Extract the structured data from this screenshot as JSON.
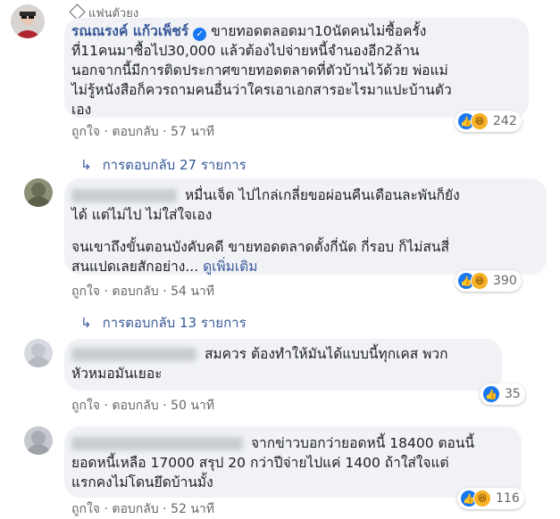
{
  "top_badge": {
    "label": "แฟนตัวยง"
  },
  "comments": [
    {
      "author": "รณณรงค์ แก้วเพ็ชร์",
      "lines": [
        "ขายทอดตลอดมา10นัดคนไม่ซื้อครั้ง",
        "ที่11คนมาซื้อไป30,000 แล้วต้องไปจ่ายหนี้จำนองอีก2ล้าน",
        "นอกจากนี้มีการติดประกาศขายทอดตลาดที่ตัวบ้านไว้ด้วย พ่อแม่",
        "ไม่รู้หนังสือก็ควรถามคนอื่นว่าใครเอาเอกสารอะไรมาแปะบ้านตัว",
        "เอง"
      ],
      "like": "ถูกใจ",
      "reply": "ตอบกลับ",
      "time": "57 นาที",
      "reaction_count": "242",
      "replies_label": "การตอบกลับ 27 รายการ"
    },
    {
      "lines": [
        "หมื่นเจ็ด ไปไกล่เกลี่ยขอผ่อนคืนเดือนละพันก็ยัง",
        "ได้ แต่ไม่ไป ไม่ใส่ใจเอง",
        "จนเขาถึงขั้นตอนบังคับคดี ขายทอดตลาดตั้งกี่นัด กี่รอบ ก็ไม่สนสี่",
        "สนแปดเลยสักอย่าง..."
      ],
      "see_more": "ดูเพิ่มเติม",
      "like": "ถูกใจ",
      "reply": "ตอบกลับ",
      "time": "54 นาที",
      "reaction_count": "390",
      "replies_label": "การตอบกลับ 13 รายการ"
    },
    {
      "lines": [
        "สมควร ต้องทำให้มันได้แบบนี้ทุกเคส พวก",
        "หัวหมอมันเยอะ"
      ],
      "like": "ถูกใจ",
      "reply": "ตอบกลับ",
      "time": "50 นาที",
      "reaction_count": "35"
    },
    {
      "lines": [
        "จากข่าวบอกว่ายอดหนี้ 18400 ตอนนี้",
        "ยอดหนี้เหลือ 17000 สรุป 20 กว่าปีจ่ายไปแค่ 1400 ถ้าใส่ใจแต่",
        "แรกคงไม่โดนยึดบ้านมั้ง"
      ],
      "like": "ถูกใจ",
      "reply": "ตอบกลับ",
      "time": "52 นาที",
      "reaction_count": "116"
    }
  ],
  "icons": {
    "like": "thumbs-up-icon",
    "haha": "laughing-face-icon",
    "verified": "verified-check-icon",
    "badge": "diamond-icon",
    "reply_arrow": "reply-arrow-icon"
  },
  "colors": {
    "link": "#385898",
    "meta": "#65676b",
    "bubble": "#f0f2f5",
    "like": "#1877f2",
    "haha": "#f7b125"
  }
}
